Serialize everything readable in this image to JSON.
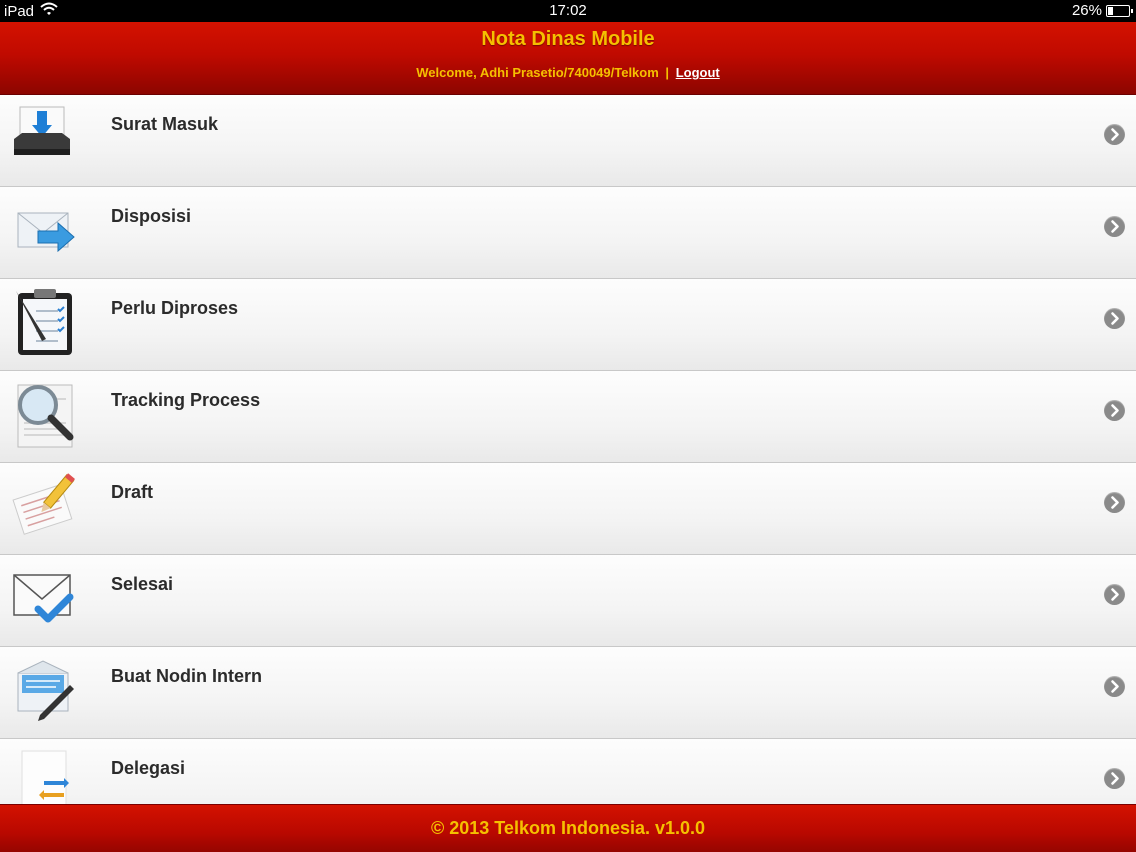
{
  "status_bar": {
    "device": "iPad",
    "time": "17:02",
    "battery": "26%",
    "battery_level": 0.26
  },
  "header": {
    "title": "Nota Dinas Mobile",
    "welcome": "Welcome, Adhi Prasetio/740049/Telkom",
    "separator": "|",
    "logout_label": "Logout"
  },
  "menu": {
    "items": [
      {
        "label": "Surat Masuk",
        "icon": "inbox-tray-icon"
      },
      {
        "label": "Disposisi",
        "icon": "forward-envelope-icon"
      },
      {
        "label": "Perlu Diproses",
        "icon": "clipboard-checklist-icon"
      },
      {
        "label": "Tracking Process",
        "icon": "magnifier-document-icon"
      },
      {
        "label": "Draft",
        "icon": "pencil-draft-icon"
      },
      {
        "label": "Selesai",
        "icon": "envelope-check-icon"
      },
      {
        "label": "Buat Nodin Intern",
        "icon": "compose-letter-icon"
      },
      {
        "label": "Delegasi",
        "icon": "document-exchange-icon"
      }
    ]
  },
  "footer": {
    "copyright": "© 2013 Telkom Indonesia. v1.0.0"
  },
  "colors": {
    "header_red": "#c00a00",
    "title_gold": "#f5c000",
    "chevron_gray": "#8a8a8a"
  }
}
